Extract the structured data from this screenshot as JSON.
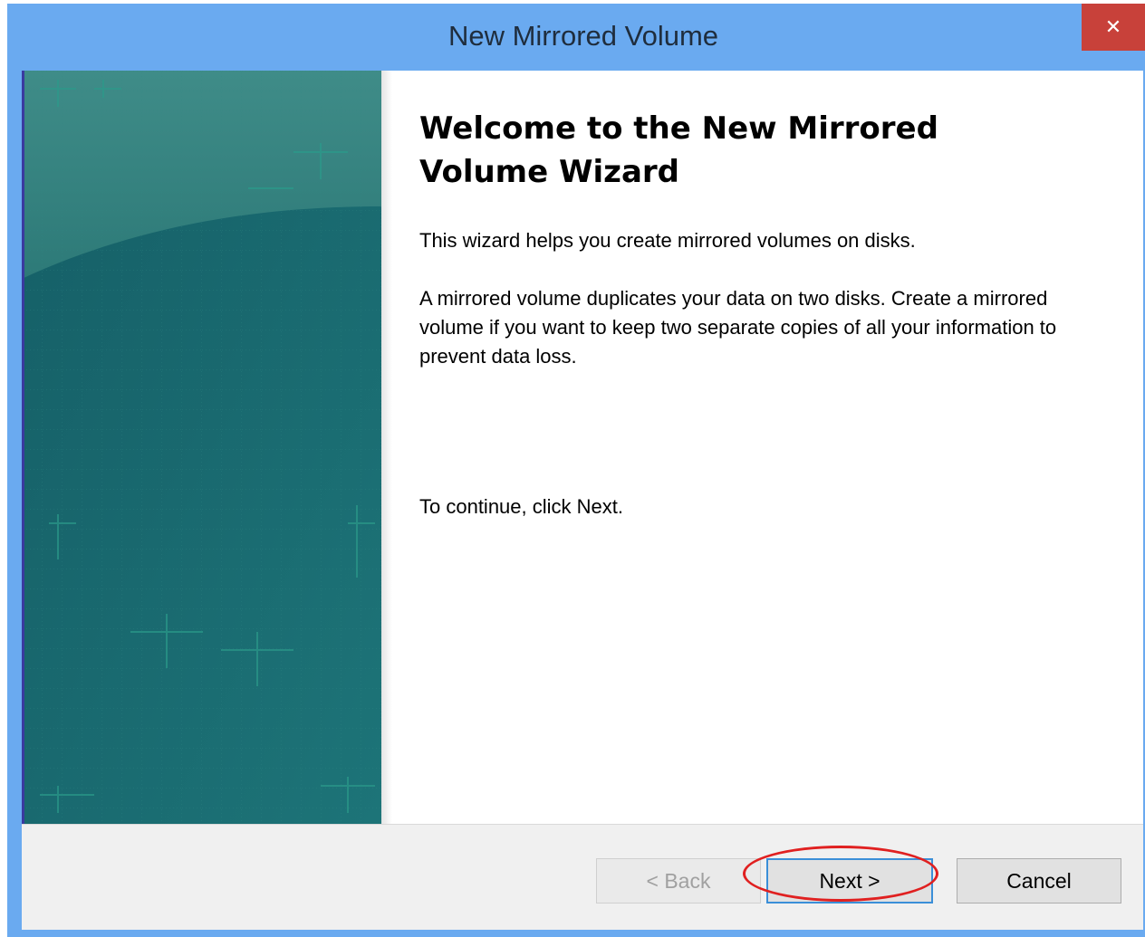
{
  "window": {
    "title": "New Mirrored Volume",
    "close_label": "✕"
  },
  "wizard": {
    "heading": "Welcome to the New Mirrored Volume Wizard",
    "intro": "This wizard helps you create mirrored volumes on disks.",
    "description": "A mirrored volume duplicates your data on two disks. Create a mirrored volume if you want to keep two separate copies of all your information to prevent  data loss.",
    "instruction": "To continue, click Next."
  },
  "buttons": {
    "back_label": "< Back",
    "next_label": "Next >",
    "cancel_label": "Cancel"
  },
  "colors": {
    "titlebar": "#6aaaf0",
    "sidebar": "#1b6a70",
    "highlight": "#e02020"
  }
}
